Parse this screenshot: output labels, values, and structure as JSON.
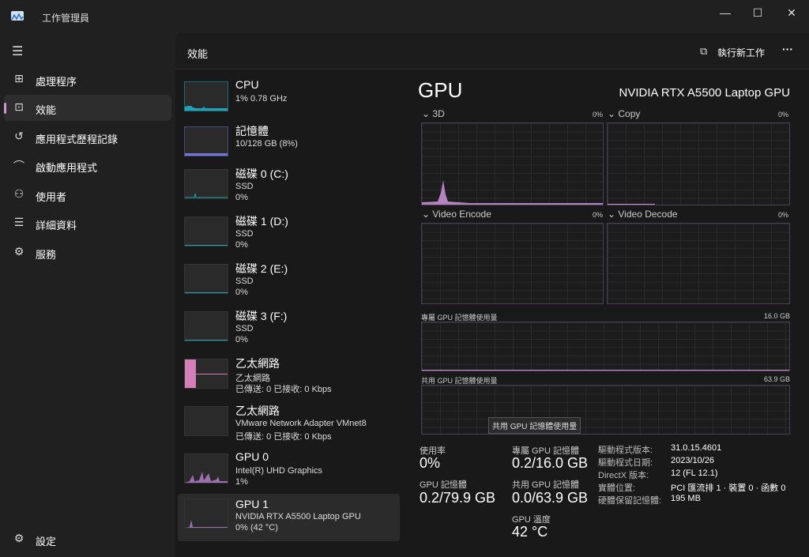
{
  "window": {
    "title": "工作管理員"
  },
  "sidebar": {
    "items": [
      {
        "label": "處理程序",
        "icon": "processes-icon"
      },
      {
        "label": "效能",
        "icon": "performance-icon"
      },
      {
        "label": "應用程式歷程記錄",
        "icon": "history-icon"
      },
      {
        "label": "啟動應用程式",
        "icon": "startup-icon"
      },
      {
        "label": "使用者",
        "icon": "users-icon"
      },
      {
        "label": "詳細資料",
        "icon": "details-icon"
      },
      {
        "label": "服務",
        "icon": "services-icon"
      }
    ],
    "settings": "設定"
  },
  "header": {
    "title": "效能",
    "run_task": "執行新工作",
    "more": "···"
  },
  "perf_list": [
    {
      "name": "CPU",
      "sub1": "1% 0.78 GHz"
    },
    {
      "name": "記憶體",
      "sub1": "10/128 GB (8%)"
    },
    {
      "name": "磁碟 0 (C:)",
      "sub1": "SSD",
      "sub2": "0%"
    },
    {
      "name": "磁碟 1 (D:)",
      "sub1": "SSD",
      "sub2": "0%"
    },
    {
      "name": "磁碟 2 (E:)",
      "sub1": "SSD",
      "sub2": "0%"
    },
    {
      "name": "磁碟 3 (F:)",
      "sub1": "SSD",
      "sub2": "0%"
    },
    {
      "name": "乙太網路",
      "sub1": "乙太網路",
      "sub2": "已傳送: 0 已接收: 0 Kbps"
    },
    {
      "name": "乙太網路",
      "sub1": "VMware Network Adapter VMnet8",
      "sub2": "已傳送: 0 已接收: 0 Kbps"
    },
    {
      "name": "GPU 0",
      "sub1": "Intel(R) UHD Graphics",
      "sub2": "1%"
    },
    {
      "name": "GPU 1",
      "sub1": "NVIDIA RTX A5500 Laptop GPU",
      "sub2": "0% (42 °C)"
    }
  ],
  "detail": {
    "title": "GPU",
    "device": "NVIDIA RTX A5500 Laptop GPU",
    "engines": [
      {
        "name": "3D",
        "pct": "0%"
      },
      {
        "name": "Copy",
        "pct": "0%"
      },
      {
        "name": "Video Encode",
        "pct": "0%"
      },
      {
        "name": "Video Decode",
        "pct": "0%"
      }
    ],
    "dedicated_label": "專屬 GPU 記憶體使用量",
    "dedicated_max": "16.0 GB",
    "shared_label": "共用 GPU 記憶體使用量",
    "shared_max": "63.9 GB",
    "tooltip": "共用 GPU 記憶體使用量",
    "stats": {
      "util_label": "使用率",
      "util": "0%",
      "gpumem_label": "GPU 記憶體",
      "gpumem": "0.2/79.9 GB",
      "ded_label": "專屬 GPU 記憶體",
      "ded": "0.2/16.0 GB",
      "shared_label": "共用 GPU 記憶體",
      "shared": "0.0/63.9 GB",
      "temp_label": "GPU 溫度",
      "temp": "42 °C"
    },
    "info": [
      {
        "k": "驅動程式版本:",
        "v": "31.0.15.4601"
      },
      {
        "k": "驅動程式日期:",
        "v": "2023/10/26"
      },
      {
        "k": "DirectX 版本:",
        "v": "12 (FL 12.1)"
      },
      {
        "k": "實體位置:",
        "v": "PCI 匯流排 1 · 裝置 0 · 函數 0"
      },
      {
        "k": "硬體保留記憶體:",
        "v": "195 MB"
      }
    ]
  },
  "colors": {
    "accent": "#d68fd6",
    "gpu": "#c58fd1",
    "cpu": "#1fa3b5",
    "memory": "#7077d6"
  }
}
